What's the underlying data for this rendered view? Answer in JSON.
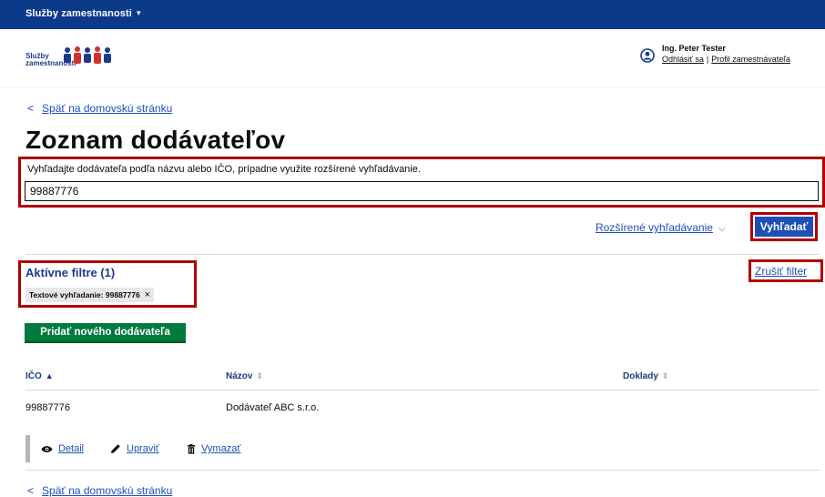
{
  "topbar": {
    "title": "Služby zamestnanosti",
    "caret": "▾"
  },
  "logo": {
    "line1": "Služby",
    "line2": "zamestnanosti"
  },
  "user": {
    "name": "Ing. Peter Tester",
    "logout": "Odhlásiť sa",
    "separator": "|",
    "profile": "Profil zamestnávateľa"
  },
  "back_top": {
    "label": "Späť na domovskú stránku",
    "chevron": "<"
  },
  "title": "Zoznam dodávateľov",
  "search": {
    "hint": "Vyhľadajte dodávateľa podľa názvu alebo IČO, prípadne využite rozšírené vyhľadávanie.",
    "value": "99887776",
    "advanced_label": "Rozšírené vyhľadávanie",
    "button_label": "Vyhľadať"
  },
  "filters": {
    "title": "Aktívne filtre (1)",
    "clear_label": "Zrušiť filter",
    "chip_label": "Textové vyhľadanie: 99887776",
    "chip_close": "×"
  },
  "add_button": "Pridať nového dodávateľa",
  "table": {
    "columns": [
      "IČO",
      "Názov",
      "Doklady"
    ],
    "rows": [
      {
        "ico": "99887776",
        "nazov": "Dodávateľ ABC s.r.o.",
        "doklady": ""
      }
    ]
  },
  "row_actions": {
    "detail": "Detail",
    "edit": "Upraviť",
    "delete": "Vymazať"
  },
  "back_bottom": {
    "label": "Späť na domovskú stránku",
    "chevron": "<"
  },
  "colors": {
    "topbar": "#0b3a8a",
    "link": "#1d4fb4",
    "primary_button": "#1d4fb4",
    "success_button": "#007a3d",
    "highlight": "#b00000"
  }
}
